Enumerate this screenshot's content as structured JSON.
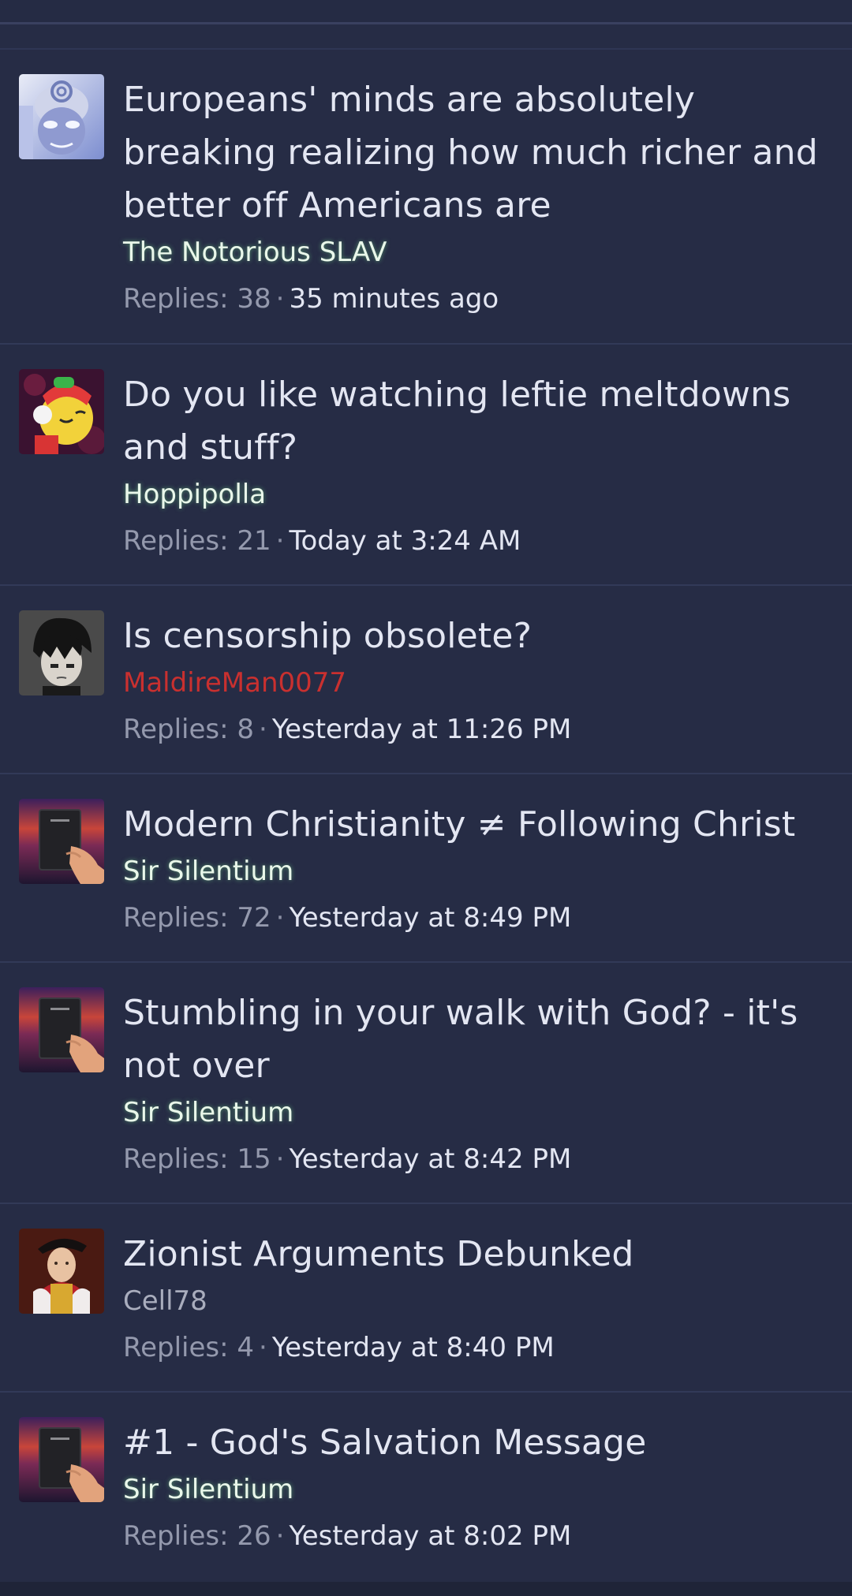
{
  "threads": [
    {
      "avatar_icon": "anime-character-avatar-icon",
      "title": "Europeans' minds are absolutely breaking realizing how much richer and better off Americans are",
      "author": "The Notorious SLAV",
      "replies_label": "Replies: 38",
      "separator": "·",
      "time": "35 minutes ago"
    },
    {
      "avatar_icon": "cartoon-character-avatar-icon",
      "title": "Do you like watching leftie meltdowns and stuff?",
      "author": "Hoppipolla",
      "replies_label": "Replies: 21",
      "separator": "·",
      "time": "Today at 3:24 AM"
    },
    {
      "avatar_icon": "anime-boy-avatar-icon",
      "title": "Is censorship obsolete?",
      "author": "MaldireMan0077",
      "replies_label": "Replies: 8",
      "separator": "·",
      "time": "Yesterday at 11:26 PM"
    },
    {
      "avatar_icon": "bible-in-hand-avatar-icon",
      "title": "Modern Christianity ≠ Following Christ",
      "author": "Sir Silentium",
      "replies_label": "Replies: 72",
      "separator": "·",
      "time": "Yesterday at 8:49 PM"
    },
    {
      "avatar_icon": "bible-in-hand-avatar-icon",
      "title": "Stumbling in your walk with God? - it's not over",
      "author": "Sir Silentium",
      "replies_label": "Replies: 15",
      "separator": "·",
      "time": "Yesterday at 8:42 PM"
    },
    {
      "avatar_icon": "renaissance-portrait-avatar-icon",
      "title": "Zionist Arguments Debunked",
      "author": "Cell78",
      "replies_label": "Replies: 4",
      "separator": "·",
      "time": "Yesterday at 8:40 PM"
    },
    {
      "avatar_icon": "bible-in-hand-avatar-icon",
      "title": "#1 - God's Salvation Message",
      "author": "Sir Silentium",
      "replies_label": "Replies: 26",
      "separator": "·",
      "time": "Yesterday at 8:02 PM"
    }
  ],
  "colors": {
    "background": "#262c45",
    "title": "#e3e6f2",
    "meta": "#9499ad",
    "author_highlight": "#e9f7ea",
    "author_plain": "#a9adbd",
    "author_red": "#c9302f"
  }
}
